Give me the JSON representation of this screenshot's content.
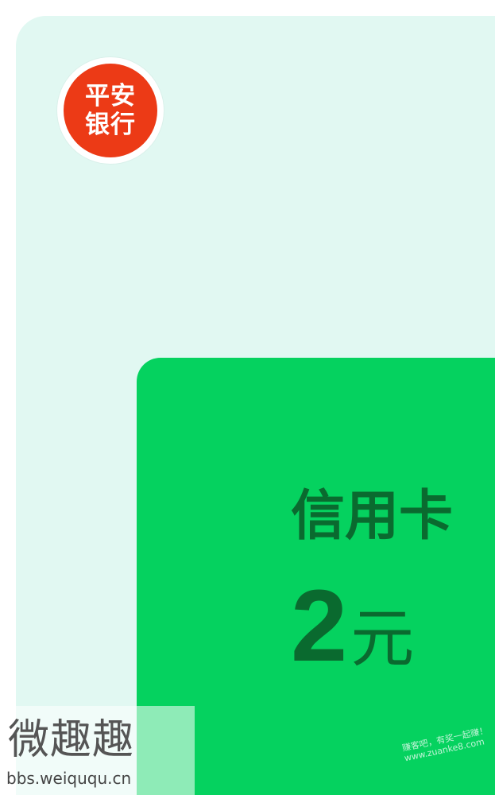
{
  "bank": {
    "logo_line1": "平安",
    "logo_line2": "银行",
    "brand_color": "#ec3a16"
  },
  "card": {
    "title": "信用卡",
    "amount": "2",
    "unit": "元",
    "background_color": "#05d25f",
    "text_color": "#0a6a2f",
    "outer_color": "#e1f8f2"
  },
  "overlay_watermark": {
    "line1": "赚客吧，有奖一起赚！",
    "line2": "www.zuanke8.com"
  },
  "site_watermark": {
    "title": "微趣趣",
    "url": "bbs.weiququ.cn"
  }
}
